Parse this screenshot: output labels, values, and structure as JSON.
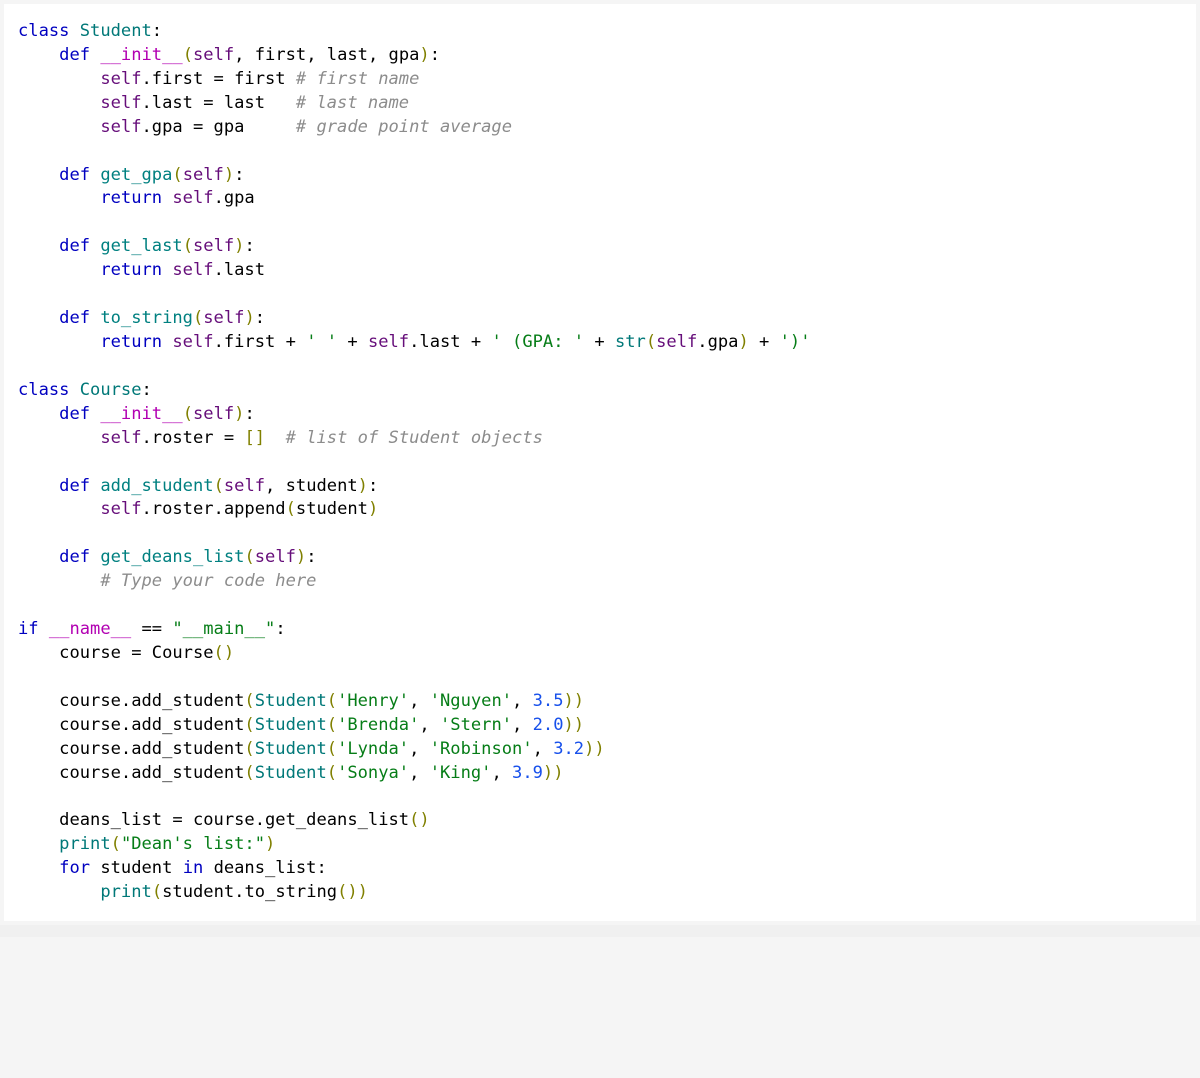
{
  "code": {
    "lines": [
      [
        {
          "t": "class ",
          "c": "tok-kw"
        },
        {
          "t": "Student",
          "c": "tok-cls"
        },
        {
          "t": ":",
          "c": ""
        }
      ],
      [
        {
          "t": "    ",
          "c": ""
        },
        {
          "t": "def ",
          "c": "tok-kw"
        },
        {
          "t": "__init__",
          "c": "tok-dund"
        },
        {
          "t": "(",
          "c": "tok-par"
        },
        {
          "t": "self",
          "c": "tok-self"
        },
        {
          "t": ", first, last, gpa",
          "c": ""
        },
        {
          "t": ")",
          "c": "tok-par"
        },
        {
          "t": ":",
          "c": ""
        }
      ],
      [
        {
          "t": "        ",
          "c": ""
        },
        {
          "t": "self",
          "c": "tok-self"
        },
        {
          "t": ".first = first ",
          "c": ""
        },
        {
          "t": "# first name",
          "c": "tok-cmt"
        }
      ],
      [
        {
          "t": "        ",
          "c": ""
        },
        {
          "t": "self",
          "c": "tok-self"
        },
        {
          "t": ".last = last   ",
          "c": ""
        },
        {
          "t": "# last name",
          "c": "tok-cmt"
        }
      ],
      [
        {
          "t": "        ",
          "c": ""
        },
        {
          "t": "self",
          "c": "tok-self"
        },
        {
          "t": ".gpa = gpa     ",
          "c": ""
        },
        {
          "t": "# grade point average",
          "c": "tok-cmt"
        }
      ],
      [
        {
          "t": " ",
          "c": ""
        }
      ],
      [
        {
          "t": "    ",
          "c": ""
        },
        {
          "t": "def ",
          "c": "tok-kw"
        },
        {
          "t": "get_gpa",
          "c": "tok-fn"
        },
        {
          "t": "(",
          "c": "tok-par"
        },
        {
          "t": "self",
          "c": "tok-self"
        },
        {
          "t": ")",
          "c": "tok-par"
        },
        {
          "t": ":",
          "c": ""
        }
      ],
      [
        {
          "t": "        ",
          "c": ""
        },
        {
          "t": "return ",
          "c": "tok-kw"
        },
        {
          "t": "self",
          "c": "tok-self"
        },
        {
          "t": ".gpa",
          "c": ""
        }
      ],
      [
        {
          "t": " ",
          "c": ""
        }
      ],
      [
        {
          "t": "    ",
          "c": ""
        },
        {
          "t": "def ",
          "c": "tok-kw"
        },
        {
          "t": "get_last",
          "c": "tok-fn"
        },
        {
          "t": "(",
          "c": "tok-par"
        },
        {
          "t": "self",
          "c": "tok-self"
        },
        {
          "t": ")",
          "c": "tok-par"
        },
        {
          "t": ":",
          "c": ""
        }
      ],
      [
        {
          "t": "        ",
          "c": ""
        },
        {
          "t": "return ",
          "c": "tok-kw"
        },
        {
          "t": "self",
          "c": "tok-self"
        },
        {
          "t": ".last",
          "c": ""
        }
      ],
      [
        {
          "t": " ",
          "c": ""
        }
      ],
      [
        {
          "t": "    ",
          "c": ""
        },
        {
          "t": "def ",
          "c": "tok-kw"
        },
        {
          "t": "to_string",
          "c": "tok-fn"
        },
        {
          "t": "(",
          "c": "tok-par"
        },
        {
          "t": "self",
          "c": "tok-self"
        },
        {
          "t": ")",
          "c": "tok-par"
        },
        {
          "t": ":",
          "c": ""
        }
      ],
      [
        {
          "t": "        ",
          "c": ""
        },
        {
          "t": "return ",
          "c": "tok-kw"
        },
        {
          "t": "self",
          "c": "tok-self"
        },
        {
          "t": ".first + ",
          "c": ""
        },
        {
          "t": "' '",
          "c": "tok-str"
        },
        {
          "t": " + ",
          "c": ""
        },
        {
          "t": "self",
          "c": "tok-self"
        },
        {
          "t": ".last + ",
          "c": ""
        },
        {
          "t": "' (GPA: '",
          "c": "tok-str"
        },
        {
          "t": " + ",
          "c": ""
        },
        {
          "t": "str",
          "c": "tok-cls"
        },
        {
          "t": "(",
          "c": "tok-par"
        },
        {
          "t": "self",
          "c": "tok-self"
        },
        {
          "t": ".gpa",
          "c": ""
        },
        {
          "t": ")",
          "c": "tok-par"
        },
        {
          "t": " + ",
          "c": ""
        },
        {
          "t": "')'",
          "c": "tok-str"
        }
      ],
      [
        {
          "t": " ",
          "c": ""
        }
      ],
      [
        {
          "t": "class ",
          "c": "tok-kw"
        },
        {
          "t": "Course",
          "c": "tok-cls"
        },
        {
          "t": ":",
          "c": ""
        }
      ],
      [
        {
          "t": "    ",
          "c": ""
        },
        {
          "t": "def ",
          "c": "tok-kw"
        },
        {
          "t": "__init__",
          "c": "tok-dund"
        },
        {
          "t": "(",
          "c": "tok-par"
        },
        {
          "t": "self",
          "c": "tok-self"
        },
        {
          "t": ")",
          "c": "tok-par"
        },
        {
          "t": ":",
          "c": ""
        }
      ],
      [
        {
          "t": "        ",
          "c": ""
        },
        {
          "t": "self",
          "c": "tok-self"
        },
        {
          "t": ".roster = ",
          "c": ""
        },
        {
          "t": "[]",
          "c": "tok-par"
        },
        {
          "t": "  ",
          "c": ""
        },
        {
          "t": "# list of Student objects",
          "c": "tok-cmt"
        }
      ],
      [
        {
          "t": " ",
          "c": ""
        }
      ],
      [
        {
          "t": "    ",
          "c": ""
        },
        {
          "t": "def ",
          "c": "tok-kw"
        },
        {
          "t": "add_student",
          "c": "tok-fn"
        },
        {
          "t": "(",
          "c": "tok-par"
        },
        {
          "t": "self",
          "c": "tok-self"
        },
        {
          "t": ", student",
          "c": ""
        },
        {
          "t": ")",
          "c": "tok-par"
        },
        {
          "t": ":",
          "c": ""
        }
      ],
      [
        {
          "t": "        ",
          "c": ""
        },
        {
          "t": "self",
          "c": "tok-self"
        },
        {
          "t": ".roster.append",
          "c": ""
        },
        {
          "t": "(",
          "c": "tok-par"
        },
        {
          "t": "student",
          "c": ""
        },
        {
          "t": ")",
          "c": "tok-par"
        }
      ],
      [
        {
          "t": " ",
          "c": ""
        }
      ],
      [
        {
          "t": "    ",
          "c": ""
        },
        {
          "t": "def ",
          "c": "tok-kw"
        },
        {
          "t": "get_deans_list",
          "c": "tok-fn"
        },
        {
          "t": "(",
          "c": "tok-par"
        },
        {
          "t": "self",
          "c": "tok-self"
        },
        {
          "t": ")",
          "c": "tok-par"
        },
        {
          "t": ":",
          "c": ""
        }
      ],
      [
        {
          "t": "        ",
          "c": ""
        },
        {
          "t": "# Type your code here",
          "c": "tok-cmt"
        }
      ],
      [
        {
          "t": " ",
          "c": ""
        }
      ],
      [
        {
          "t": "if ",
          "c": "tok-kw"
        },
        {
          "t": "__name__",
          "c": "tok-dund"
        },
        {
          "t": " == ",
          "c": ""
        },
        {
          "t": "\"__main__\"",
          "c": "tok-str"
        },
        {
          "t": ":",
          "c": ""
        }
      ],
      [
        {
          "t": "    course = Course",
          "c": ""
        },
        {
          "t": "()",
          "c": "tok-par"
        }
      ],
      [
        {
          "t": " ",
          "c": ""
        }
      ],
      [
        {
          "t": "    course.add_student",
          "c": ""
        },
        {
          "t": "(",
          "c": "tok-par"
        },
        {
          "t": "Student",
          "c": "tok-cls"
        },
        {
          "t": "(",
          "c": "tok-par"
        },
        {
          "t": "'Henry'",
          "c": "tok-str"
        },
        {
          "t": ", ",
          "c": ""
        },
        {
          "t": "'Nguyen'",
          "c": "tok-str"
        },
        {
          "t": ", ",
          "c": ""
        },
        {
          "t": "3.5",
          "c": "tok-num"
        },
        {
          "t": "))",
          "c": "tok-par"
        }
      ],
      [
        {
          "t": "    course.add_student",
          "c": ""
        },
        {
          "t": "(",
          "c": "tok-par"
        },
        {
          "t": "Student",
          "c": "tok-cls"
        },
        {
          "t": "(",
          "c": "tok-par"
        },
        {
          "t": "'Brenda'",
          "c": "tok-str"
        },
        {
          "t": ", ",
          "c": ""
        },
        {
          "t": "'Stern'",
          "c": "tok-str"
        },
        {
          "t": ", ",
          "c": ""
        },
        {
          "t": "2.0",
          "c": "tok-num"
        },
        {
          "t": "))",
          "c": "tok-par"
        }
      ],
      [
        {
          "t": "    course.add_student",
          "c": ""
        },
        {
          "t": "(",
          "c": "tok-par"
        },
        {
          "t": "Student",
          "c": "tok-cls"
        },
        {
          "t": "(",
          "c": "tok-par"
        },
        {
          "t": "'Lynda'",
          "c": "tok-str"
        },
        {
          "t": ", ",
          "c": ""
        },
        {
          "t": "'Robinson'",
          "c": "tok-str"
        },
        {
          "t": ", ",
          "c": ""
        },
        {
          "t": "3.2",
          "c": "tok-num"
        },
        {
          "t": "))",
          "c": "tok-par"
        }
      ],
      [
        {
          "t": "    course.add_student",
          "c": ""
        },
        {
          "t": "(",
          "c": "tok-par"
        },
        {
          "t": "Student",
          "c": "tok-cls"
        },
        {
          "t": "(",
          "c": "tok-par"
        },
        {
          "t": "'Sonya'",
          "c": "tok-str"
        },
        {
          "t": ", ",
          "c": ""
        },
        {
          "t": "'King'",
          "c": "tok-str"
        },
        {
          "t": ", ",
          "c": ""
        },
        {
          "t": "3.9",
          "c": "tok-num"
        },
        {
          "t": "))",
          "c": "tok-par"
        }
      ],
      [
        {
          "t": " ",
          "c": ""
        }
      ],
      [
        {
          "t": "    deans_list = course.get_deans_list",
          "c": ""
        },
        {
          "t": "()",
          "c": "tok-par"
        }
      ],
      [
        {
          "t": "    ",
          "c": ""
        },
        {
          "t": "print",
          "c": "tok-cls"
        },
        {
          "t": "(",
          "c": "tok-par"
        },
        {
          "t": "\"Dean's list:\"",
          "c": "tok-str"
        },
        {
          "t": ")",
          "c": "tok-par"
        }
      ],
      [
        {
          "t": "    ",
          "c": ""
        },
        {
          "t": "for ",
          "c": "tok-kw"
        },
        {
          "t": "student ",
          "c": ""
        },
        {
          "t": "in ",
          "c": "tok-kw"
        },
        {
          "t": "deans_list:",
          "c": ""
        }
      ],
      [
        {
          "t": "        ",
          "c": ""
        },
        {
          "t": "print",
          "c": "tok-cls"
        },
        {
          "t": "(",
          "c": "tok-par"
        },
        {
          "t": "student.to_string",
          "c": ""
        },
        {
          "t": "()",
          "c": "tok-par"
        },
        {
          "t": ")",
          "c": "tok-par"
        }
      ]
    ]
  }
}
